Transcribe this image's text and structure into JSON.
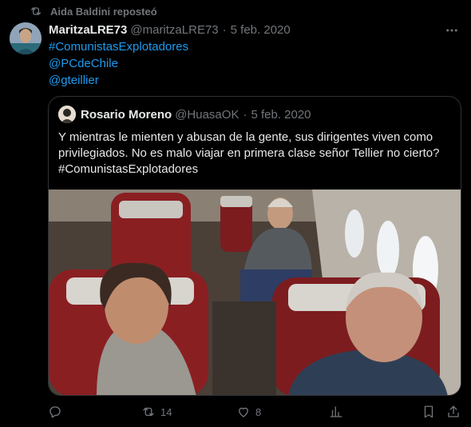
{
  "repost": {
    "text": "Aida Baldini reposteó",
    "icon": "repost-icon"
  },
  "tweet": {
    "name": "MaritzaLRE73",
    "handle": "@maritzaLRE73",
    "dot": "·",
    "date": "5 feb. 2020",
    "lines": [
      "#ComunistasExplotadores",
      "@PCdeChile",
      "@gteillier"
    ]
  },
  "quote": {
    "name": "Rosario Moreno",
    "handle": "@HuasaOK",
    "dot": "·",
    "date": "5 feb. 2020",
    "text": "Y mientras le mienten y abusan de la gente, sus dirigentes viven como privilegiados. No es malo viajar en primera clase señor Tellier no cierto?",
    "hashtag": "#ComunistasExplotadores"
  },
  "actions": {
    "reply": {
      "icon": "reply-icon"
    },
    "repost": {
      "icon": "repost-icon",
      "count": "14"
    },
    "like": {
      "icon": "heart-icon",
      "count": "8"
    },
    "views": {
      "icon": "views-icon"
    },
    "bookmark": {
      "icon": "bookmark-icon"
    },
    "share": {
      "icon": "share-icon"
    }
  },
  "colors": {
    "background": "#000000",
    "text": "#e7e9ea",
    "muted": "#71767b",
    "link": "#1d9bf0",
    "border": "#2f3336"
  }
}
